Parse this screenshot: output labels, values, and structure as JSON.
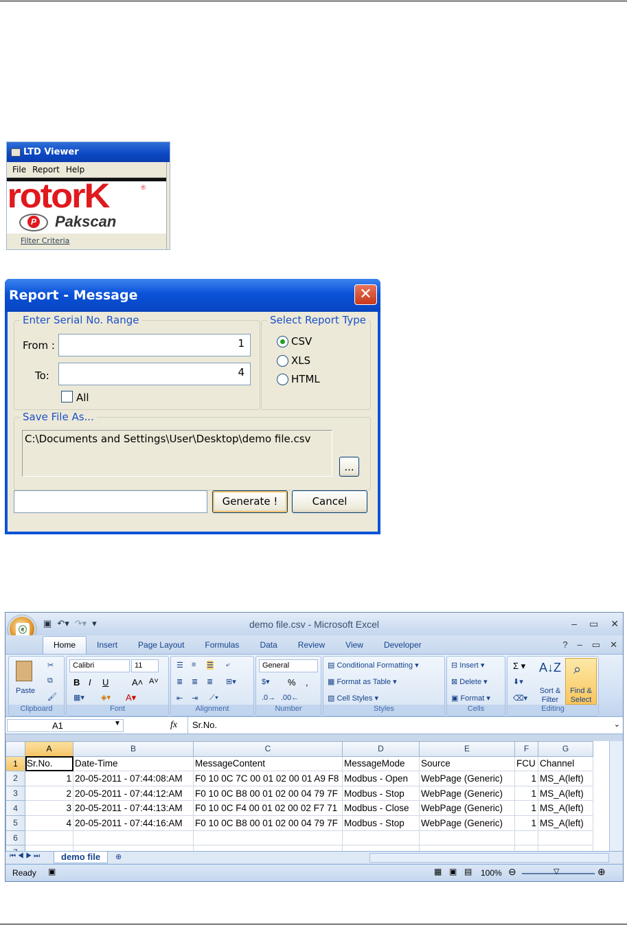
{
  "ltd": {
    "title": "LTD Viewer",
    "menu": [
      "File",
      "Report",
      "Help"
    ],
    "logo_text": "rotorK",
    "product": "Pakscan",
    "filter_label": "Filter Criteria"
  },
  "dialog": {
    "title": "Report - Message",
    "close": "✕",
    "range_legend": "Enter Serial No. Range",
    "from_label": "From :",
    "from_value": "1",
    "to_label": "To:",
    "to_value": "4",
    "all_label": "All",
    "type_legend": "Select Report Type",
    "types": [
      "CSV",
      "XLS",
      "HTML"
    ],
    "selected_type": "CSV",
    "save_legend": "Save File As...",
    "save_path": "C:\\Documents and Settings\\User\\Desktop\\demo file.csv",
    "browse": "...",
    "status_value": "",
    "generate": "Generate !",
    "cancel": "Cancel"
  },
  "excel": {
    "title": "demo file.csv - Microsoft Excel",
    "tabs": [
      "Home",
      "Insert",
      "Page Layout",
      "Formulas",
      "Data",
      "Review",
      "View",
      "Developer"
    ],
    "ribbon": {
      "clipboard": {
        "label": "Clipboard",
        "paste": "Paste"
      },
      "font": {
        "label": "Font",
        "name": "Calibri",
        "size": "11"
      },
      "alignment": {
        "label": "Alignment"
      },
      "number": {
        "label": "Number",
        "format": "General"
      },
      "styles": {
        "label": "Styles",
        "items": [
          "Conditional Formatting",
          "Format as Table",
          "Cell Styles"
        ]
      },
      "cells": {
        "label": "Cells",
        "items": [
          "Insert",
          "Delete",
          "Format"
        ]
      },
      "editing": {
        "label": "Editing",
        "sort": "Sort & Filter",
        "find": "Find & Select"
      }
    },
    "name_box": "A1",
    "formula": "Sr.No.",
    "columns": [
      "A",
      "B",
      "C",
      "D",
      "E",
      "F",
      "G"
    ],
    "rows": [
      [
        "Sr.No.",
        "Date-Time",
        "MessageContent",
        "MessageMode",
        "Source",
        "FCU",
        "Channel"
      ],
      [
        "1",
        "20-05-2011 - 07:44:08:AM",
        "F0 10 0C 7C 00 01 02 00 01 A9 F8",
        "Modbus - Open",
        "WebPage (Generic)",
        "1",
        "MS_A(left)"
      ],
      [
        "2",
        "20-05-2011 - 07:44:12:AM",
        "F0 10 0C B8 00 01 02 00 04 79 7F",
        "Modbus - Stop",
        "WebPage (Generic)",
        "1",
        "MS_A(left)"
      ],
      [
        "3",
        "20-05-2011 - 07:44:13:AM",
        "F0 10 0C F4 00 01 02 00 02 F7 71",
        "Modbus - Close",
        "WebPage (Generic)",
        "1",
        "MS_A(left)"
      ],
      [
        "4",
        "20-05-2011 - 07:44:16:AM",
        "F0 10 0C B8 00 01 02 00 04 79 7F",
        "Modbus - Stop",
        "WebPage (Generic)",
        "1",
        "MS_A(left)"
      ],
      [
        "",
        "",
        "",
        "",
        "",
        "",
        ""
      ],
      [
        "",
        "",
        "",
        "",
        "",
        "",
        ""
      ]
    ],
    "sheet_tab": "demo file",
    "status": "Ready",
    "zoom": "100%"
  }
}
